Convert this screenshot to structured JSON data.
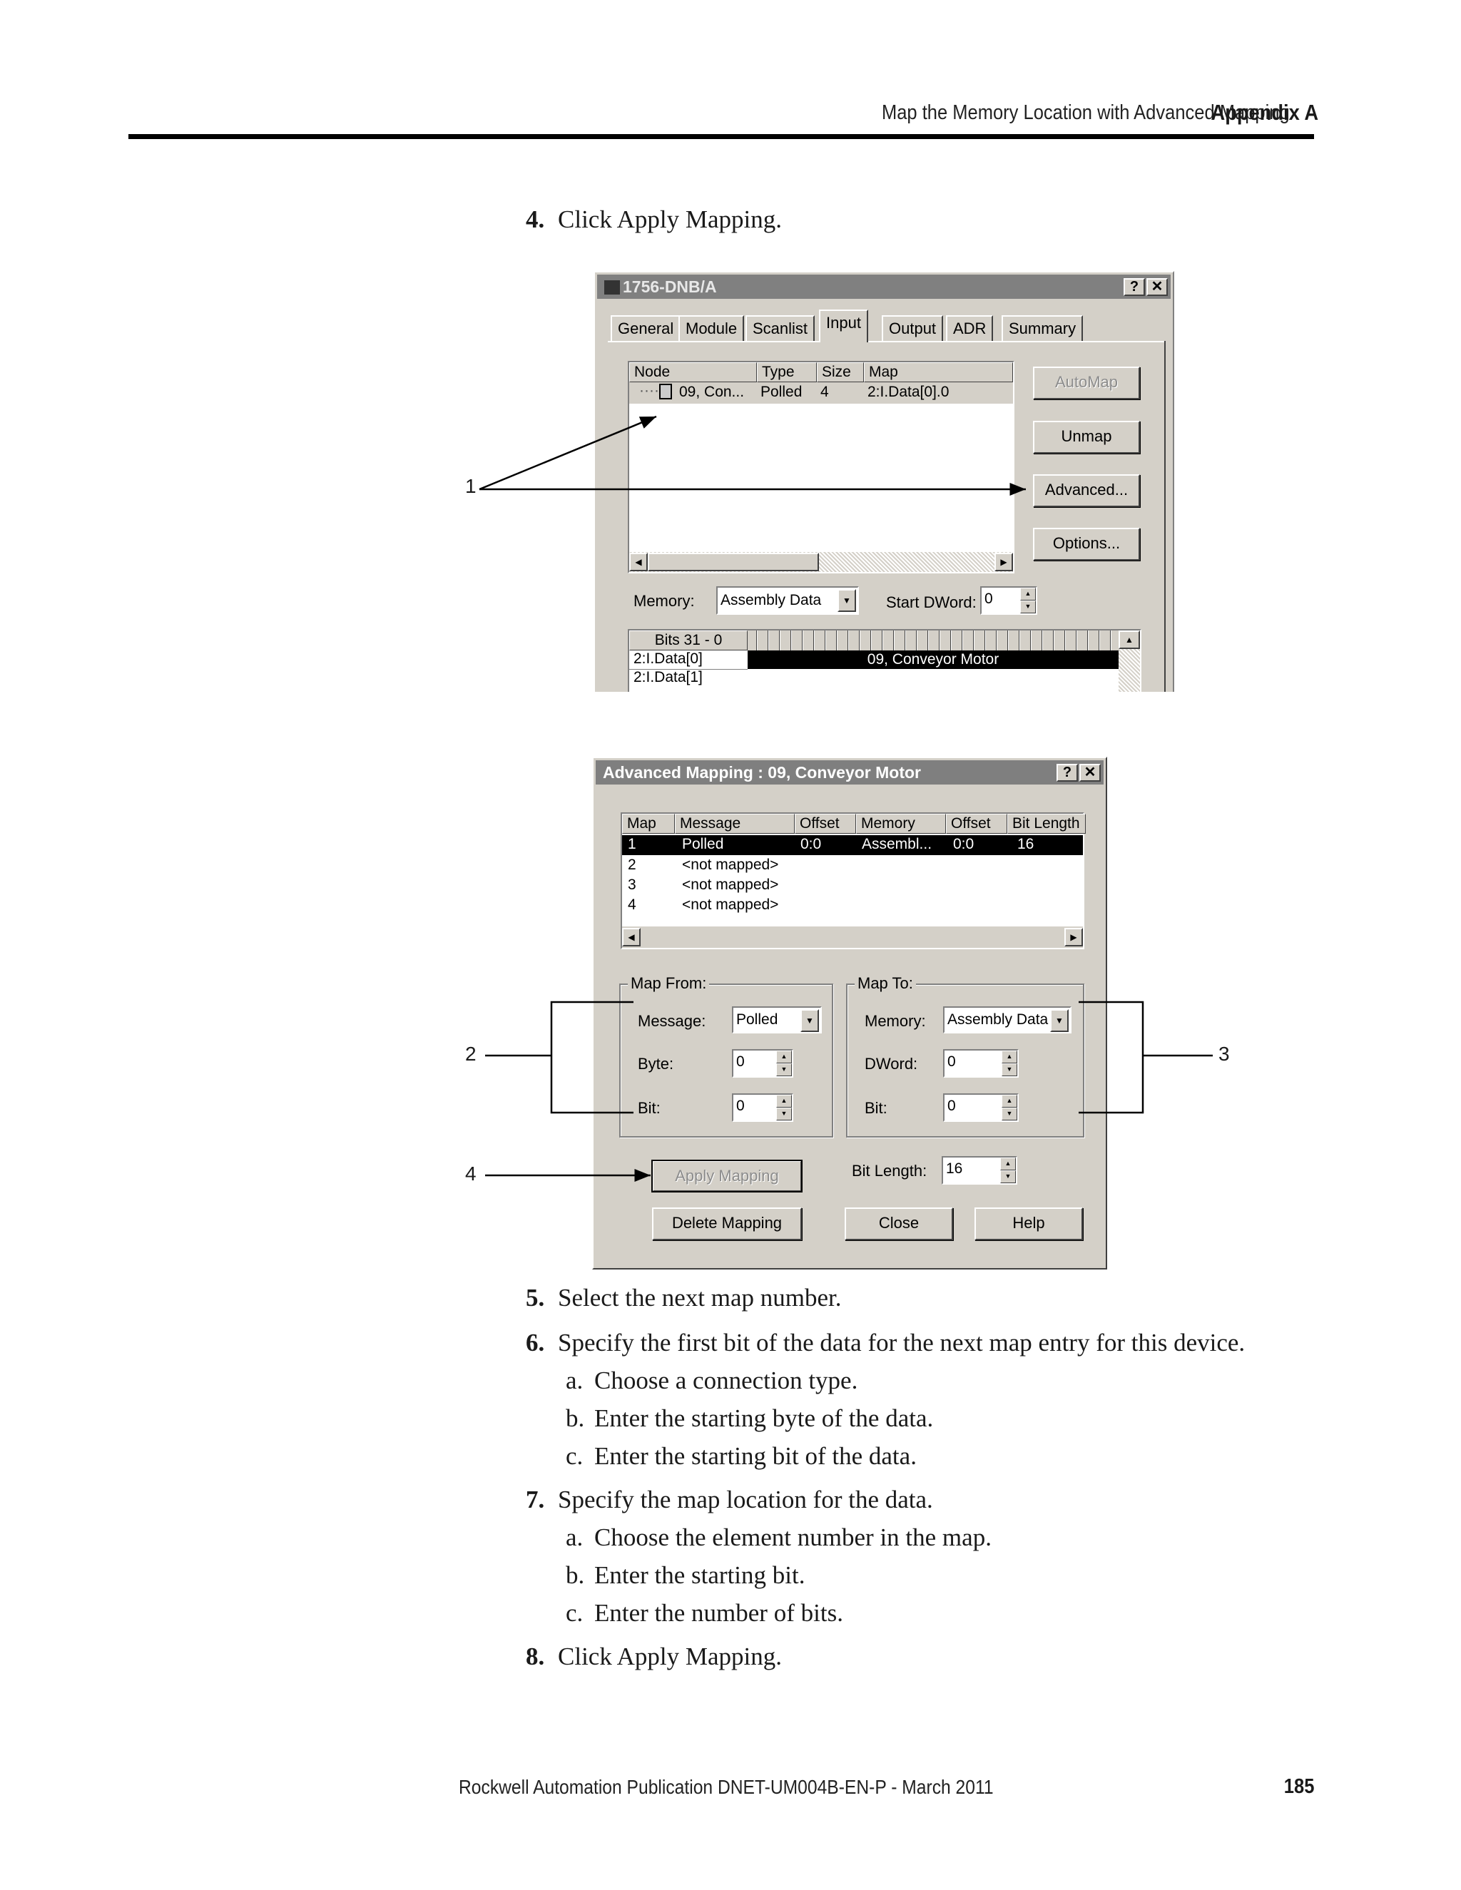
{
  "header": {
    "section_title": "Map the Memory Location with Advanced Mapping",
    "appendix": "Appendix A"
  },
  "footer": {
    "publication": "Rockwell Automation Publication DNET-UM004B-EN-P - March 2011",
    "page_number": "185"
  },
  "steps_top": [
    {
      "num": "4.",
      "text": "Click Apply Mapping."
    }
  ],
  "steps_bottom": [
    {
      "num": "5.",
      "text": "Select the next map number."
    },
    {
      "num": "6.",
      "text": "Specify the first bit of the data for the next map entry for this device."
    },
    {
      "num": "7.",
      "text": "Specify the map location for the data."
    },
    {
      "num": "8.",
      "text": "Click Apply Mapping."
    }
  ],
  "substeps6": [
    {
      "letter": "a.",
      "text": "Choose a connection type."
    },
    {
      "letter": "b.",
      "text": "Enter the starting byte of the data."
    },
    {
      "letter": "c.",
      "text": "Enter the starting bit of the data."
    }
  ],
  "substeps7": [
    {
      "letter": "a.",
      "text": "Choose the element number in the map."
    },
    {
      "letter": "b.",
      "text": "Enter the starting bit."
    },
    {
      "letter": "c.",
      "text": "Enter the number of bits."
    }
  ],
  "scanner_dialog": {
    "title": "1756-DNB/A",
    "help_btn": "?",
    "close_btn": "✕",
    "tabs": [
      "General",
      "Module",
      "Scanlist",
      "Input",
      "Output",
      "ADR",
      "Summary"
    ],
    "active_tab": "Input",
    "columns": [
      "Node",
      "Type",
      "Size",
      "Map"
    ],
    "row": {
      "node": "09, Con...",
      "type": "Polled",
      "size": "4",
      "map": "2:I.Data[0].0"
    },
    "buttons": {
      "automap": "AutoMap",
      "unmap": "Unmap",
      "advanced": "Advanced...",
      "options": "Options..."
    },
    "memory_label": "Memory:",
    "memory_value": "Assembly Data",
    "start_dword_label": "Start DWord:",
    "start_dword_value": "0",
    "bits_header": "Bits 31 - 0",
    "bits_rows": [
      "2:I.Data[0]",
      "2:I.Data[1]"
    ],
    "bits_bar_label": "09, Conveyor Motor"
  },
  "advanced_dialog": {
    "title": "Advanced Mapping : 09, Conveyor Motor",
    "help_btn": "?",
    "close_btn": "✕",
    "columns": [
      "Map",
      "Message",
      "Offset",
      "Memory",
      "Offset",
      "Bit Length"
    ],
    "rows": [
      {
        "map": "1",
        "message": "Polled",
        "offset": "0:0",
        "memory": "Assembl...",
        "offset2": "0:0",
        "bit_length": "16"
      },
      {
        "map": "2",
        "message": "<not mapped>",
        "offset": "",
        "memory": "",
        "offset2": "",
        "bit_length": ""
      },
      {
        "map": "3",
        "message": "<not mapped>",
        "offset": "",
        "memory": "",
        "offset2": "",
        "bit_length": ""
      },
      {
        "map": "4",
        "message": "<not mapped>",
        "offset": "",
        "memory": "",
        "offset2": "",
        "bit_length": ""
      }
    ],
    "map_from": {
      "legend": "Map From:",
      "message_label": "Message:",
      "message_value": "Polled",
      "byte_label": "Byte:",
      "byte_value": "0",
      "bit_label": "Bit:",
      "bit_value": "0"
    },
    "map_to": {
      "legend": "Map To:",
      "memory_label": "Memory:",
      "memory_value": "Assembly Data",
      "dword_label": "DWord:",
      "dword_value": "0",
      "bit_label": "Bit:",
      "bit_value": "0"
    },
    "bit_length_label": "Bit Length:",
    "bit_length_value": "16",
    "buttons": {
      "apply": "Apply Mapping",
      "delete": "Delete Mapping",
      "close": "Close",
      "help": "Help"
    }
  },
  "callouts": [
    "1",
    "2",
    "3",
    "4"
  ]
}
